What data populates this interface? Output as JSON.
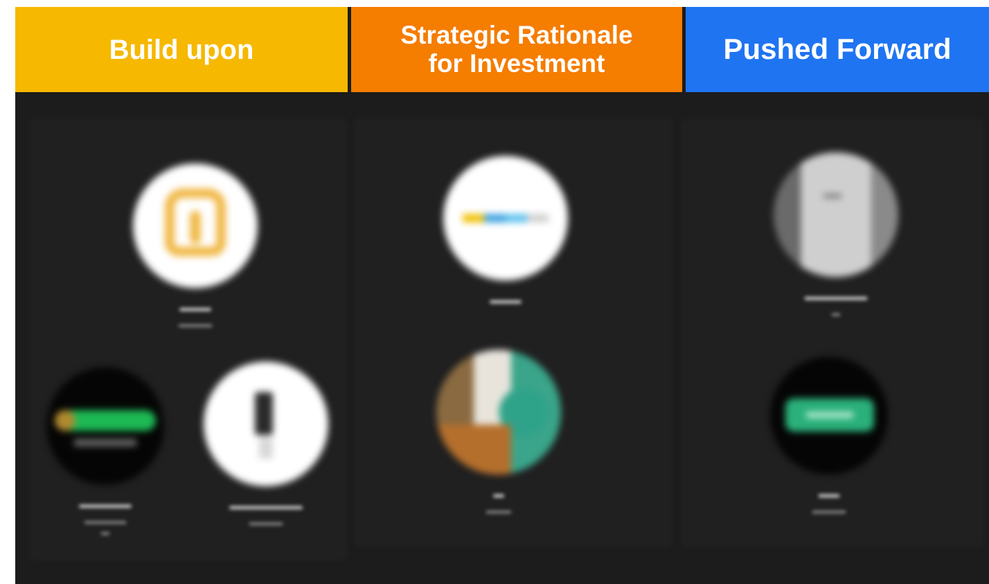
{
  "columns": [
    {
      "title": "Build upon",
      "color": "#f6b800"
    },
    {
      "title": "Strategic Rationale\nfor Investment",
      "color": "#f57d00"
    },
    {
      "title": "Pushed Forward",
      "color": "#1f74f2"
    }
  ]
}
